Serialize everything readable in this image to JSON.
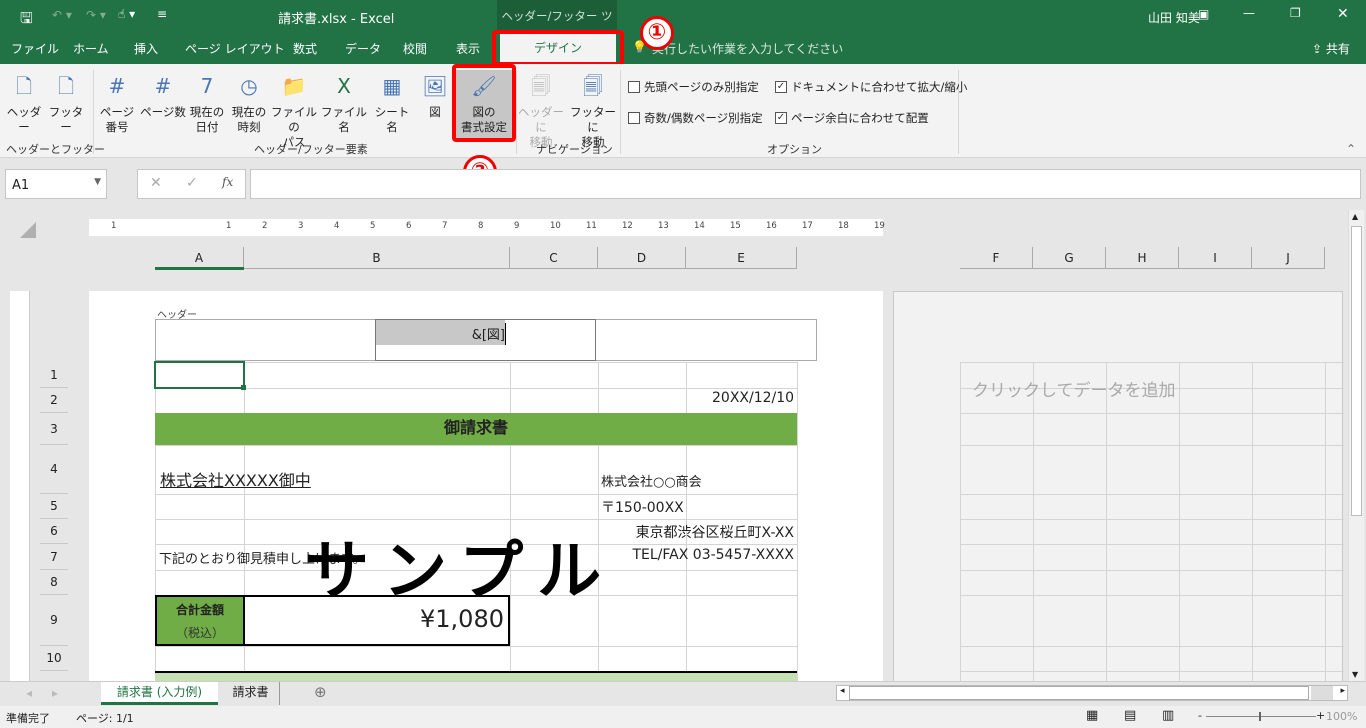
{
  "titlebar": {
    "filename": "請求書.xlsx",
    "separator": "-",
    "app": "Excel",
    "context_tool": "ヘッダー/フッター ツール",
    "user": "山田 知美"
  },
  "tabs": [
    "ファイル",
    "ホーム",
    "挿入",
    "ページ レイアウト",
    "数式",
    "データ",
    "校閲",
    "表示",
    "デザイン"
  ],
  "active_tab": "デザイン",
  "tell_me": "実行したい作業を入力してください",
  "share": "共有",
  "ribbon": {
    "group1": {
      "label": "ヘッダーとフッター",
      "buttons": [
        {
          "label": "ヘッダー",
          "icon": "header-icon"
        },
        {
          "label": "フッター",
          "icon": "footer-icon"
        }
      ]
    },
    "group2": {
      "label": "ヘッダー/フッター要素",
      "buttons": [
        {
          "label": "ページ\n番号",
          "icon": "page-number-icon"
        },
        {
          "label": "ページ数",
          "icon": "page-count-icon"
        },
        {
          "label": "現在の\n日付",
          "icon": "calendar-icon"
        },
        {
          "label": "現在の\n時刻",
          "icon": "clock-icon"
        },
        {
          "label": "ファイルの\nパス",
          "icon": "folder-icon"
        },
        {
          "label": "ファイル名",
          "icon": "excel-file-icon"
        },
        {
          "label": "シート名",
          "icon": "sheet-icon"
        },
        {
          "label": "図",
          "icon": "picture-icon"
        },
        {
          "label": "図の\n書式設定",
          "icon": "format-picture-icon"
        }
      ]
    },
    "group3": {
      "label": "ナビゲーション",
      "buttons": [
        {
          "label": "ヘッダーに\n移動",
          "icon": "go-to-header-icon",
          "disabled": true
        },
        {
          "label": "フッターに\n移動",
          "icon": "go-to-footer-icon"
        }
      ]
    },
    "options": {
      "label": "オプション",
      "checks": [
        {
          "label": "先頭ページのみ別指定",
          "checked": false
        },
        {
          "label": "奇数/偶数ページ別指定",
          "checked": false
        },
        {
          "label": "ドキュメントに合わせて拡大/縮小",
          "checked": true
        },
        {
          "label": "ページ余白に合わせて配置",
          "checked": true
        }
      ]
    }
  },
  "annotations": [
    "①",
    "②"
  ],
  "formula": {
    "namebox": "A1",
    "cancel": "✕",
    "enter": "✓",
    "fx": "fx",
    "value": ""
  },
  "ruler": [
    "1",
    "1",
    "2",
    "3",
    "4",
    "5",
    "6",
    "7",
    "8",
    "9",
    "10",
    "11",
    "12",
    "13",
    "14",
    "15",
    "16",
    "17",
    "18",
    "19"
  ],
  "columns_left": [
    "A",
    "B",
    "C",
    "D",
    "E"
  ],
  "columns_right": [
    "F",
    "G",
    "H",
    "I",
    "J"
  ],
  "rows": [
    "1",
    "2",
    "3",
    "4",
    "5",
    "6",
    "7",
    "8",
    "9",
    "10"
  ],
  "header": {
    "label": "ヘッダー",
    "center_code": "&[図]"
  },
  "cells": {
    "date": "20XX/12/10",
    "title": "御請求書",
    "client": "株式会社XXXXX御中",
    "company": "株式会社○○商会",
    "zip": "〒150-00XX",
    "address": "東京都渋谷区桜丘町X-XX",
    "tel": "TEL/FAX 03-5457-XXXX",
    "note": "下記のとおり御見積申し上げます。",
    "total_label": "合計金額",
    "total_sub": "（税込）",
    "total_value": "¥1,080"
  },
  "watermark": "サンプル",
  "right_page_placeholder": "クリックしてデータを追加",
  "sheets": [
    "請求書 (入力例)",
    "請求書"
  ],
  "active_sheet": "請求書 (入力例)",
  "status": {
    "ready": "準備完了",
    "page": "ページ: 1/1",
    "zoom": "100%"
  },
  "colors": {
    "excel_green": "#217346",
    "title_fill": "#70ad47",
    "table_header_fill": "#c6e0b4",
    "highlight": "#ff0000"
  }
}
